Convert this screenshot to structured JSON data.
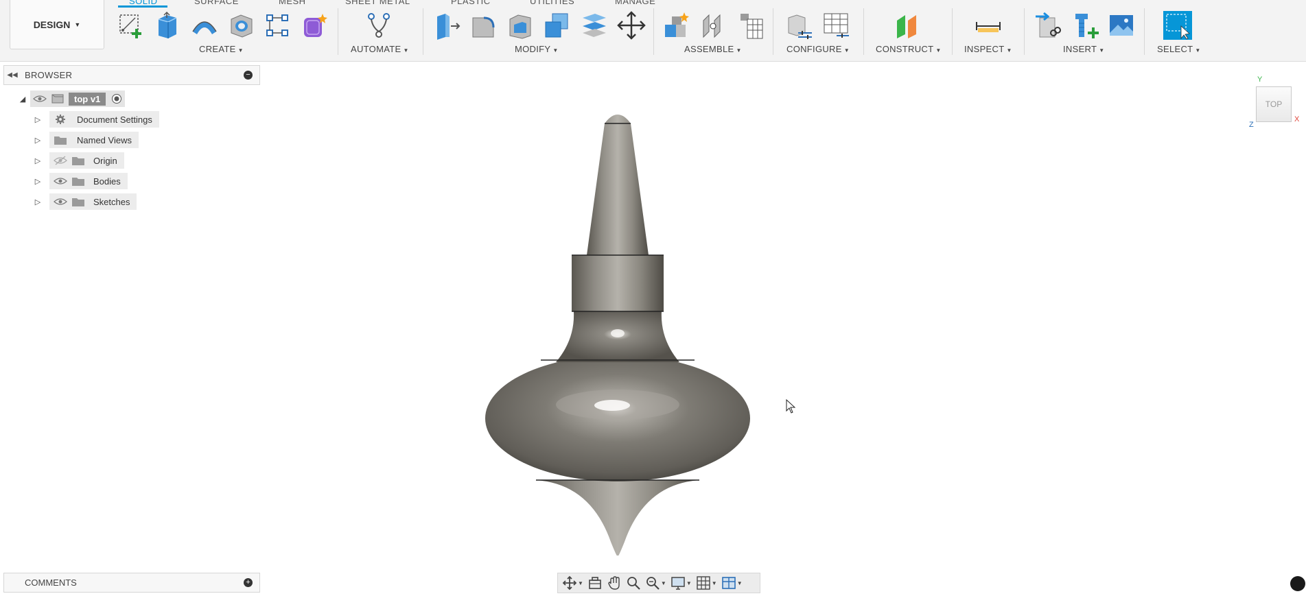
{
  "workspace": {
    "design_label": "DESIGN"
  },
  "tabs": [
    {
      "label": "SOLID"
    },
    {
      "label": "SURFACE"
    },
    {
      "label": "MESH"
    },
    {
      "label": "SHEET METAL"
    },
    {
      "label": "PLASTIC"
    },
    {
      "label": "UTILITIES"
    },
    {
      "label": "MANAGE"
    }
  ],
  "toolbar": {
    "groups": {
      "create": "CREATE",
      "automate": "AUTOMATE",
      "modify": "MODIFY",
      "assemble": "ASSEMBLE",
      "configure": "CONFIGURE",
      "construct": "CONSTRUCT",
      "inspect": "INSPECT",
      "insert": "INSERT",
      "select": "SELECT"
    },
    "icons": [
      "create-sketch-icon",
      "extrude-icon",
      "sweep-icon",
      "hole-icon",
      "sketch-pattern-icon",
      "form-icon",
      "automate-icon",
      "press-pull-icon",
      "fillet-icon",
      "shell-icon",
      "combine-icon",
      "split-face-icon",
      "move-icon",
      "new-component-icon",
      "joint-icon",
      "bill-of-materials-icon",
      "parameters-icon",
      "configuration-table-icon",
      "offset-plane-icon",
      "measure-icon",
      "insert-derive-icon",
      "insert-mcmaster-icon",
      "insert-image-icon",
      "window-select-icon"
    ],
    "accent": "#0696d7"
  },
  "browser": {
    "title": "BROWSER",
    "root": {
      "label": "top v1"
    },
    "items": [
      {
        "label": "Document Settings",
        "icon": "gear-icon"
      },
      {
        "label": "Named Views",
        "icon": "folder-icon"
      },
      {
        "label": "Origin",
        "icon": "folder-icon",
        "visible": false
      },
      {
        "label": "Bodies",
        "icon": "folder-icon",
        "visible": true
      },
      {
        "label": "Sketches",
        "icon": "folder-icon",
        "visible": true
      }
    ]
  },
  "viewcube": {
    "face_label": "TOP",
    "axes": {
      "y": "Y",
      "x": "X",
      "z": "Z"
    }
  },
  "comments": {
    "title": "COMMENTS"
  }
}
